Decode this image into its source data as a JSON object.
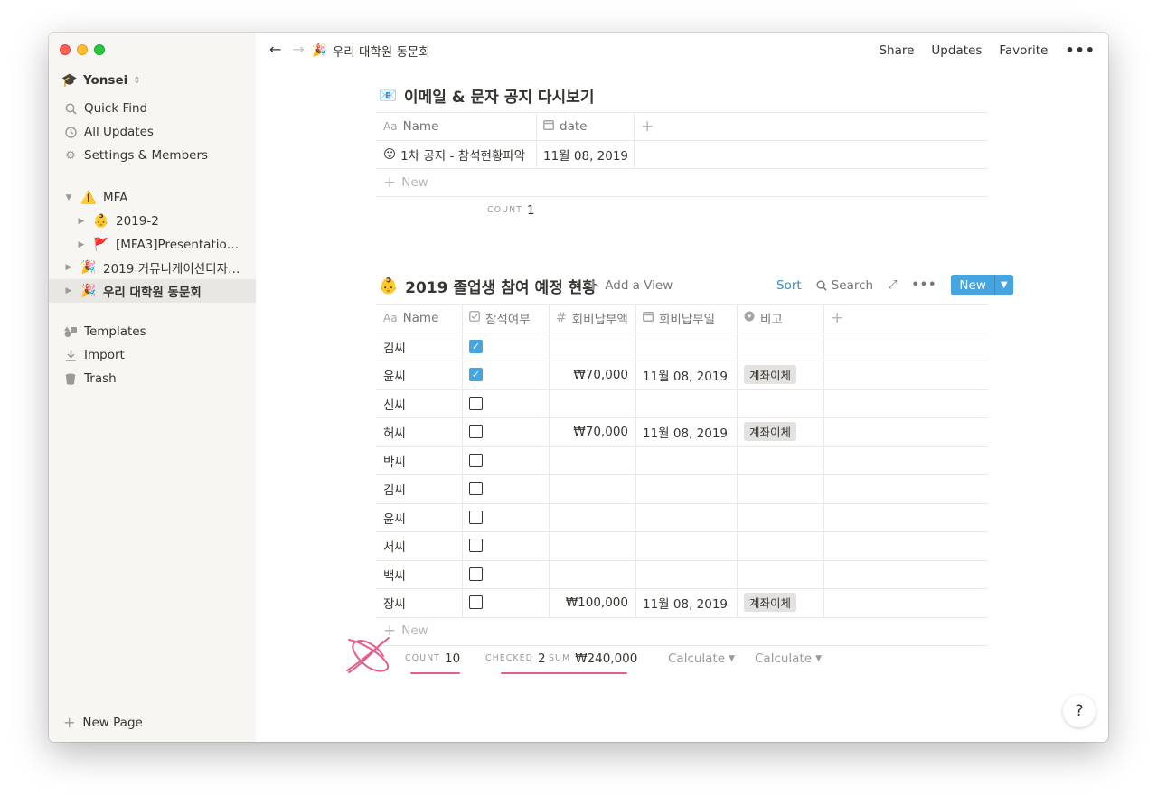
{
  "window_controls": [
    "close",
    "minimize",
    "zoom"
  ],
  "sidebar": {
    "workspace": {
      "icon": "🎓",
      "name": "Yonsei",
      "chevron": "⇕"
    },
    "actions": [
      {
        "icon": "search-icon",
        "label": "Quick Find"
      },
      {
        "icon": "clock-icon",
        "label": "All Updates"
      },
      {
        "icon": "gear-icon",
        "label": "Settings & Members"
      }
    ],
    "pages": [
      {
        "emoji": "⚠️",
        "label": "MFA",
        "expanded": true
      },
      {
        "emoji": "👶",
        "label": "2019-2"
      },
      {
        "emoji": "🚩",
        "label": "[MFA3]Presentation ..."
      },
      {
        "emoji": "🎉",
        "label": "2019 커뮤니케이션디자인..."
      },
      {
        "emoji": "🎉",
        "label": "우리 대학원 동문회",
        "active": true
      }
    ],
    "bottom": [
      {
        "icon": "templates-icon",
        "label": "Templates"
      },
      {
        "icon": "import-icon",
        "label": "Import"
      },
      {
        "icon": "trash-icon",
        "label": "Trash"
      }
    ],
    "new_page": "New Page"
  },
  "topbar": {
    "breadcrumb_emoji": "🎉",
    "breadcrumb": "우리 대학원 동문회",
    "share": "Share",
    "updates": "Updates",
    "favorite": "Favorite",
    "more": "•••"
  },
  "db1": {
    "emoji": "📧",
    "title": "이메일 & 문자 공지 다시보기",
    "columns": [
      {
        "icon": "Aa",
        "label": "Name"
      },
      {
        "icon": "calendar",
        "label": "date"
      }
    ],
    "rows": [
      {
        "emoji": "😛",
        "name": "1차 공지 - 참석현황파악",
        "date": "11월 08, 2019"
      }
    ],
    "new_row": "New",
    "count_label": "COUNT",
    "count_value": "1"
  },
  "db2": {
    "emoji": "👶",
    "title": "2019 졸업생 참여 예정 현황",
    "add_view": "Add a View",
    "sort": "Sort",
    "search": "Search",
    "new_button": "New",
    "columns": [
      {
        "icon": "Aa",
        "label": "Name"
      },
      {
        "icon": "checkbox",
        "label": "참석여부"
      },
      {
        "icon": "#",
        "label": "회비납부액"
      },
      {
        "icon": "calendar",
        "label": "회비납부일"
      },
      {
        "icon": "select",
        "label": "비고"
      }
    ],
    "rows": [
      {
        "name": "김씨",
        "attend": true,
        "amount": "",
        "date": "",
        "note": ""
      },
      {
        "name": "윤씨",
        "attend": true,
        "amount": "₩70,000",
        "date": "11월 08, 2019",
        "note": "계좌이체"
      },
      {
        "name": "신씨",
        "attend": false,
        "amount": "",
        "date": "",
        "note": ""
      },
      {
        "name": "허씨",
        "attend": false,
        "amount": "₩70,000",
        "date": "11월 08, 2019",
        "note": "계좌이체"
      },
      {
        "name": "박씨",
        "attend": false,
        "amount": "",
        "date": "",
        "note": ""
      },
      {
        "name": "김씨",
        "attend": false,
        "amount": "",
        "date": "",
        "note": ""
      },
      {
        "name": "윤씨",
        "attend": false,
        "amount": "",
        "date": "",
        "note": ""
      },
      {
        "name": "서씨",
        "attend": false,
        "amount": "",
        "date": "",
        "note": ""
      },
      {
        "name": "백씨",
        "attend": false,
        "amount": "",
        "date": "",
        "note": ""
      },
      {
        "name": "장씨",
        "attend": false,
        "amount": "₩100,000",
        "date": "11월 08, 2019",
        "note": "계좌이체"
      }
    ],
    "new_row": "New",
    "calc": {
      "count_label": "COUNT",
      "count_value": "10",
      "checked_label": "CHECKED",
      "checked_value": "2",
      "sum_label": "SUM",
      "sum_value": "₩240,000",
      "calculate_1": "Calculate",
      "calculate_2": "Calculate"
    }
  },
  "help": "?",
  "colors": {
    "accent": "#46a4de",
    "annotation": "#e55d8f",
    "sidebar_bg": "#f7f6f3"
  }
}
